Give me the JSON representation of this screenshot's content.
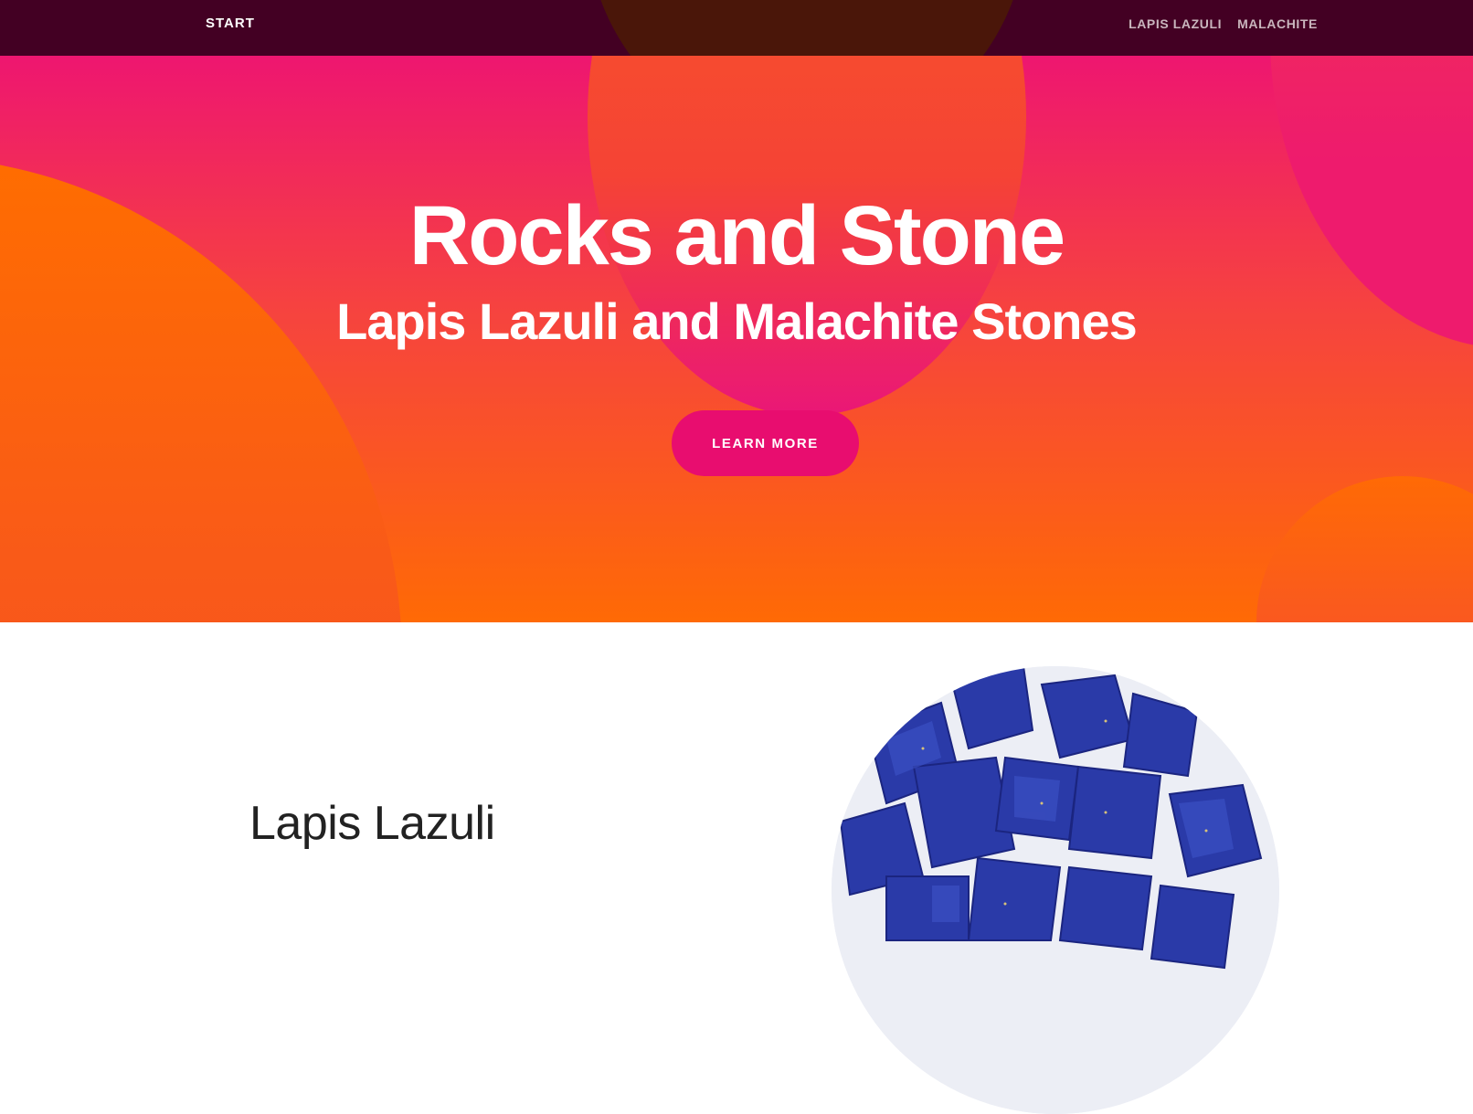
{
  "navbar": {
    "brand": "START",
    "links": [
      "LAPIS LAZULI",
      "MALACHITE"
    ]
  },
  "hero": {
    "title": "Rocks and Stone",
    "subtitle": "Lapis Lazuli and Malachite Stones",
    "button_label": "LEARN MORE"
  },
  "section": {
    "title": "Lapis Lazuli"
  },
  "colors": {
    "navbar_bg": "#430023",
    "hero_top": "#ee1670",
    "hero_bottom": "#ff6a05",
    "button_bg": "#e80d6f",
    "lapis_blue": "#2a3aa8"
  }
}
